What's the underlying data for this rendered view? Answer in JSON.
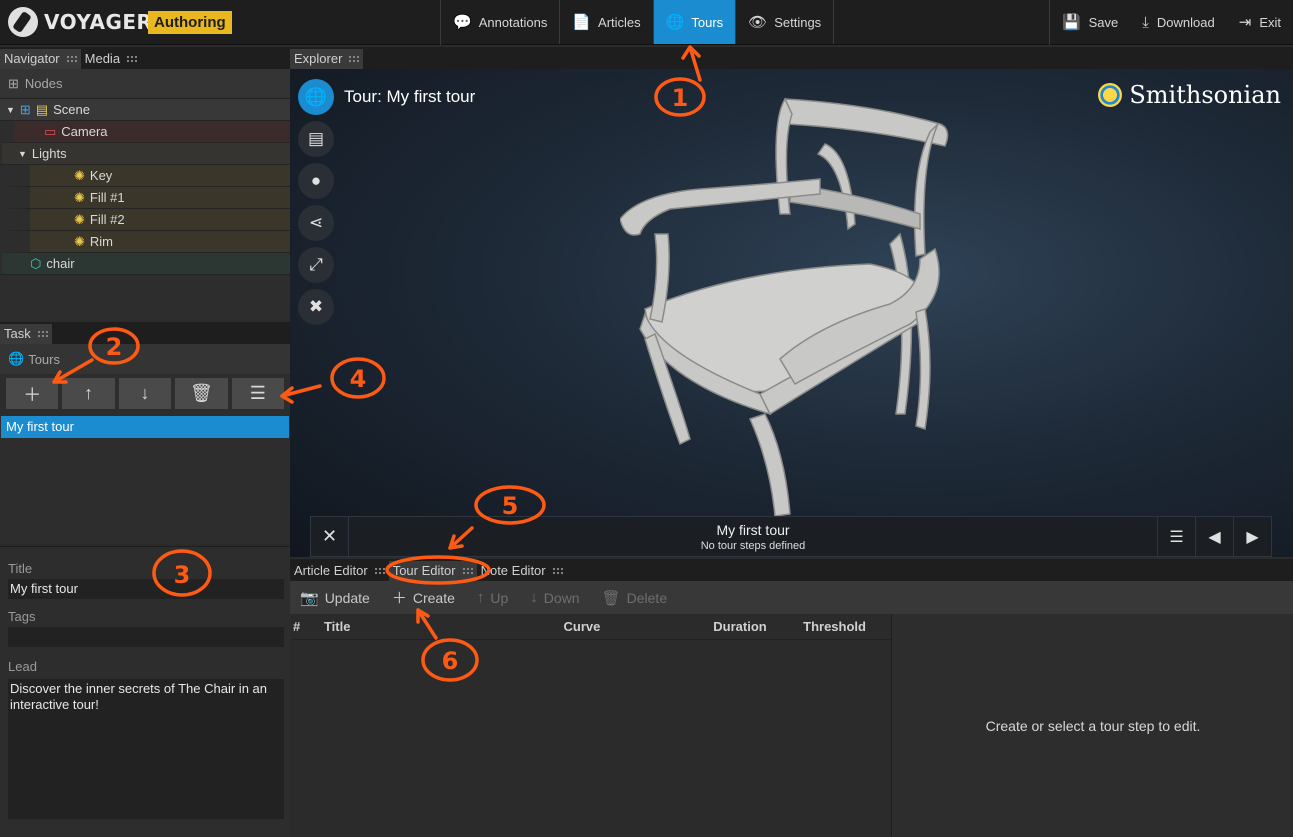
{
  "app": {
    "name": "VOYAGER",
    "mode_badge": "Authoring"
  },
  "nav": {
    "items": [
      {
        "label": "Annotations",
        "icon": "comment-icon"
      },
      {
        "label": "Articles",
        "icon": "document-icon"
      },
      {
        "label": "Tours",
        "icon": "globe-icon",
        "active": true
      },
      {
        "label": "Settings",
        "icon": "eye-icon"
      }
    ]
  },
  "actions": {
    "save": "Save",
    "download": "Download",
    "exit": "Exit"
  },
  "left_tabs": {
    "navigator": "Navigator",
    "media": "Media"
  },
  "navigator": {
    "header": "Nodes",
    "tree": {
      "scene": "Scene",
      "camera": "Camera",
      "lights": "Lights",
      "light_items": [
        "Key",
        "Fill #1",
        "Fill #2",
        "Rim"
      ],
      "model": "chair"
    }
  },
  "task": {
    "tab": "Task",
    "header": "Tours",
    "tours": [
      "My first tour"
    ]
  },
  "properties": {
    "title_label": "Title",
    "title_value": "My first tour",
    "tags_label": "Tags",
    "tags_value": "",
    "lead_label": "Lead",
    "lead_value": "Discover the inner secrets of The Chair in an interactive tour!"
  },
  "explorer": {
    "tab": "Explorer",
    "tour_title": "Tour: My first tour",
    "brand": "Smithsonian",
    "tourbar": {
      "name": "My first tour",
      "status": "No tour steps defined"
    }
  },
  "editor_tabs": {
    "article": "Article Editor",
    "tour": "Tour Editor",
    "note": "Note Editor"
  },
  "tour_editor": {
    "toolbar": {
      "update": "Update",
      "create": "Create",
      "up": "Up",
      "down": "Down",
      "delete": "Delete"
    },
    "columns": [
      "#",
      "Title",
      "Curve",
      "Duration",
      "Threshold"
    ],
    "empty_hint": "Create or select a tour step to edit."
  },
  "annotations": [
    "1",
    "2",
    "3",
    "4",
    "5",
    "6"
  ],
  "colors": {
    "accent": "#1b8ccf",
    "badge": "#e9b81f",
    "annotation": "#ff5a14"
  }
}
